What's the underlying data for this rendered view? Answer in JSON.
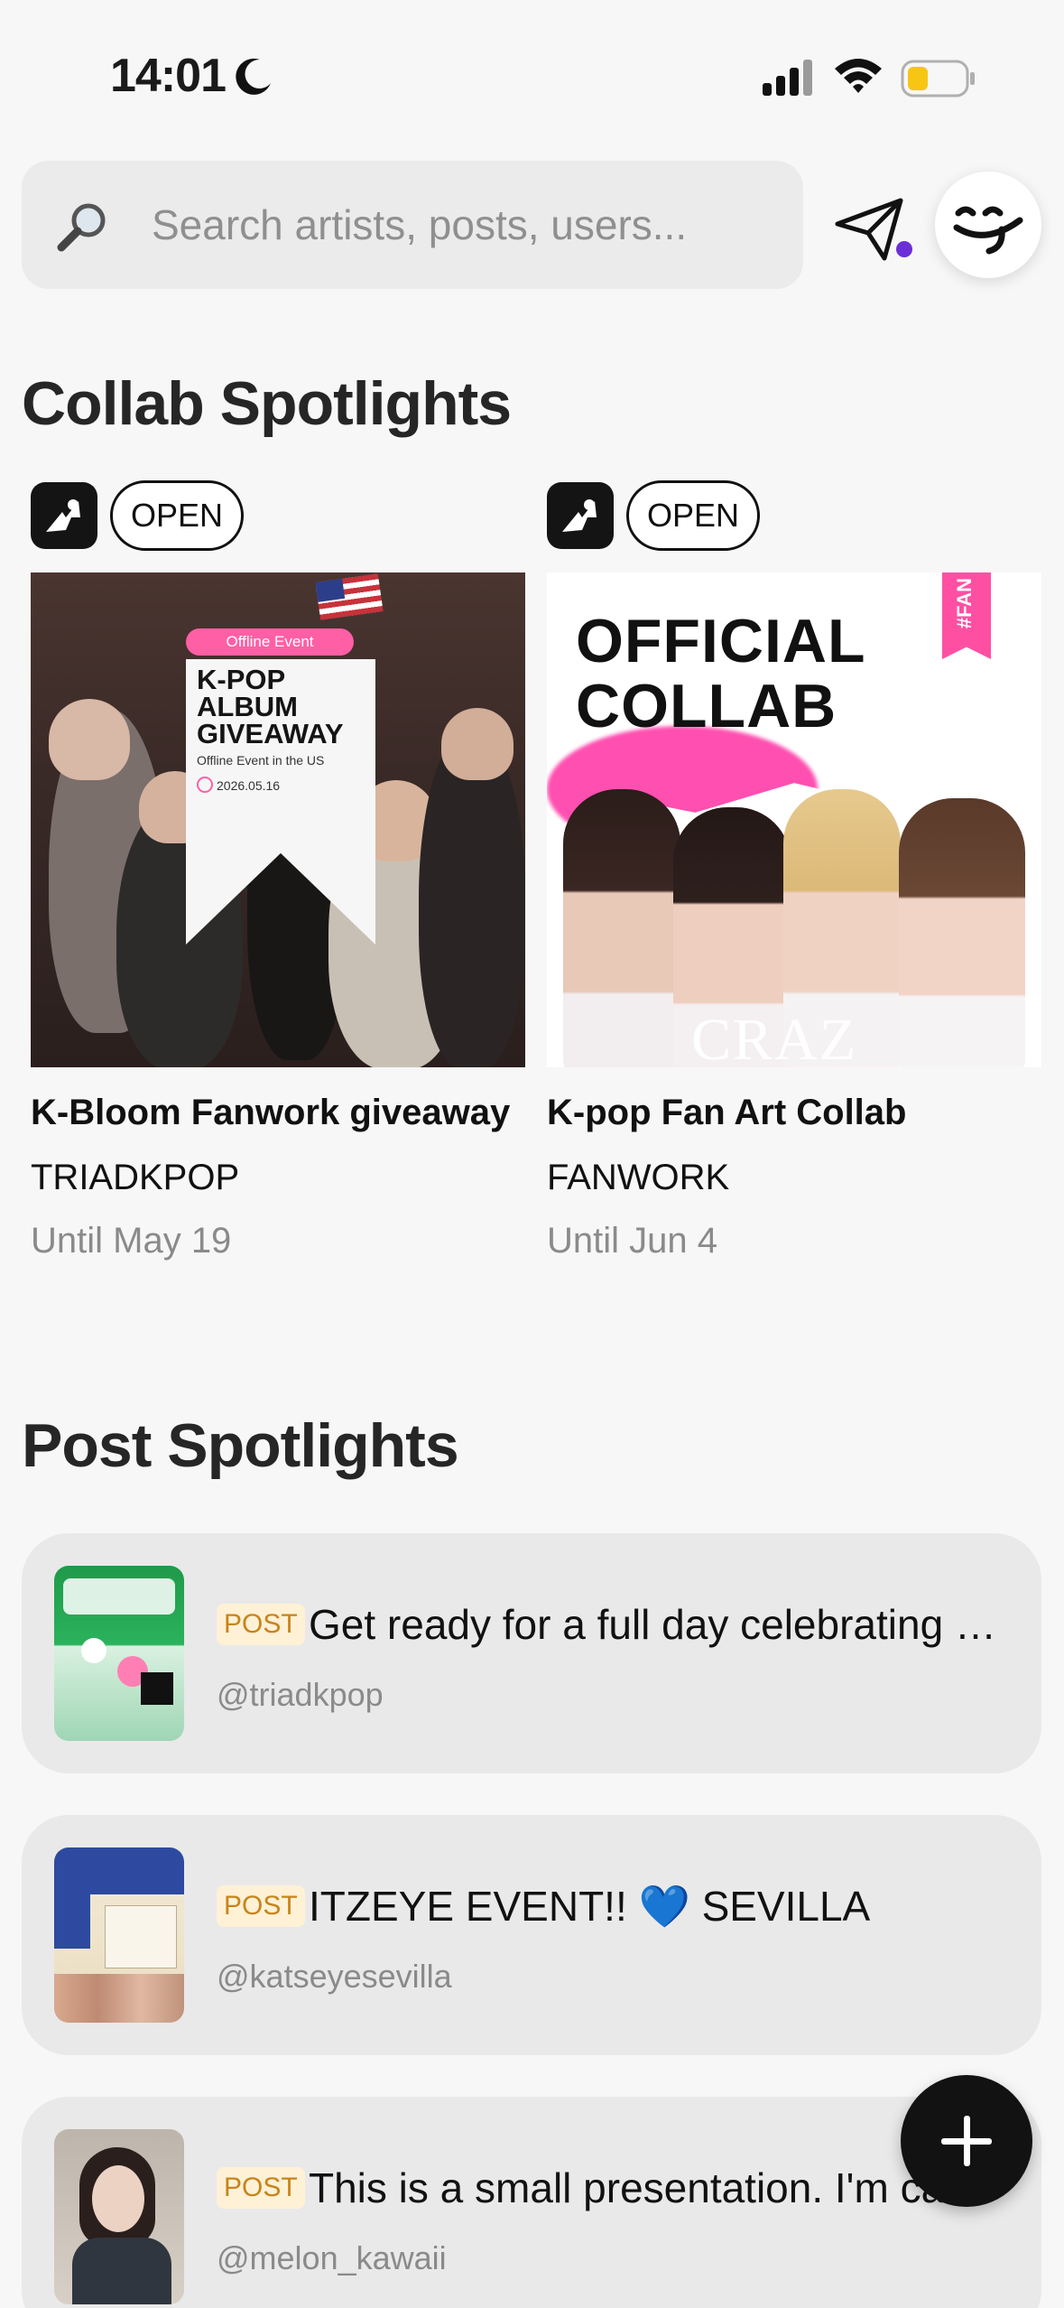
{
  "status_bar": {
    "time": "14:01",
    "icons": [
      "moon-icon",
      "signal-icon",
      "wifi-icon",
      "battery-icon"
    ]
  },
  "search": {
    "placeholder": "Search artists, posts, users..."
  },
  "colors": {
    "background": "#f7f7f7",
    "card_background": "#e9e9e9",
    "post_label_bg": "#fff1d6",
    "post_label_text": "#c8841a",
    "notification_dot": "#6b2fd6",
    "muted_text": "#8a8a8a"
  },
  "collab_spotlights": {
    "title": "Collab Spotlights",
    "cards": [
      {
        "status": "OPEN",
        "title": "K-Bloom Fanwork giveaway",
        "organizer": "TRIADKPOP",
        "until": "Until May 19",
        "image": {
          "tag": "Offline Event",
          "headline": "K-POP ALBUM GIVEAWAY",
          "subtitle": "Offline Event in the US",
          "date": "2026.05.16"
        }
      },
      {
        "status": "OPEN",
        "title": "K-pop Fan Art Collab",
        "organizer": "FANWORK",
        "until": "Until Jun 4",
        "image": {
          "headline": "OFFICIAL COLLAB",
          "ribbon": "#FAN",
          "footer": "CRAZ"
        }
      }
    ]
  },
  "post_spotlights": {
    "title": "Post Spotlights",
    "posts": [
      {
        "label": "POST",
        "text": "Get ready for a full day celebrating K-Bloom Fan Fest!",
        "user": "@triadkpop"
      },
      {
        "label": "POST",
        "text": "ITZEYE EVENT!! 💙 SEVILLA",
        "user": "@katseyesevilla"
      },
      {
        "label": "POST",
        "text": "This is a small presentation. I'm ca",
        "user": "@melon_kawaii"
      }
    ]
  }
}
